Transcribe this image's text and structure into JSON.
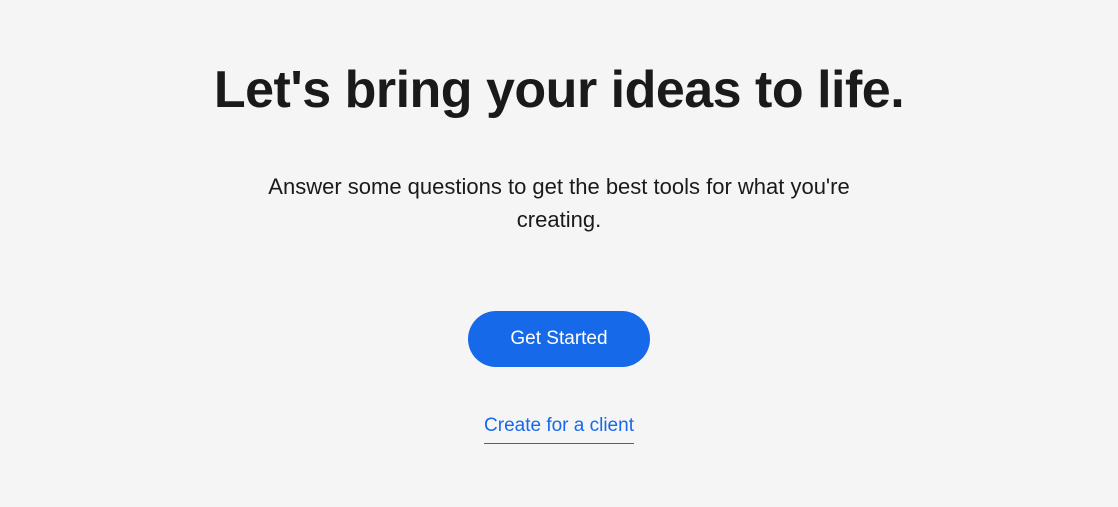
{
  "heading": "Let's bring your ideas to life.",
  "subheading": "Answer some questions to get the best tools for what you're creating.",
  "cta": {
    "primary_label": "Get Started",
    "secondary_label": "Create for a client"
  },
  "colors": {
    "accent": "#166aea",
    "background": "#f5f5f5",
    "text": "#1a1a1a"
  }
}
